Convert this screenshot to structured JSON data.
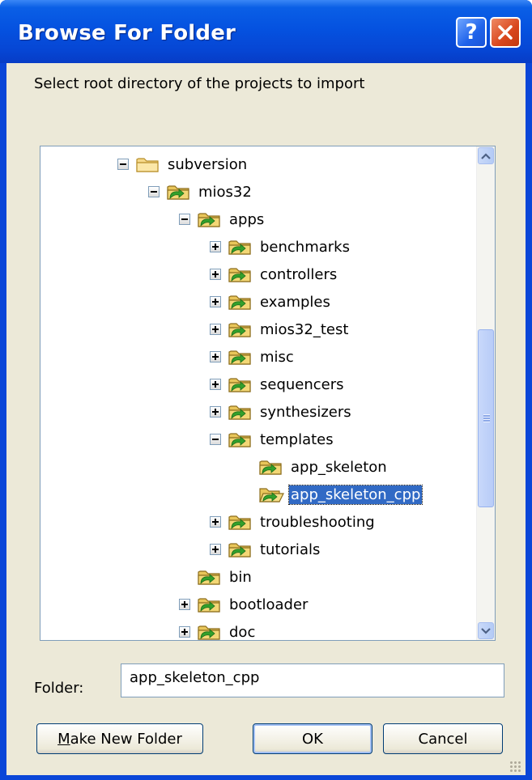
{
  "window": {
    "title": "Browse For Folder",
    "help_label": "?",
    "accent": "#0a46d8"
  },
  "dialog": {
    "instruction": "Select root directory of the projects to import",
    "folder_label": "Folder:",
    "folder_value": "app_skeleton_cpp"
  },
  "tree": {
    "items": [
      {
        "label": "subversion",
        "expander": "minus",
        "icon": "folder-icon"
      },
      {
        "label": "mios32",
        "expander": "minus",
        "icon": "svn-folder-icon"
      },
      {
        "label": "apps",
        "expander": "minus",
        "icon": "svn-folder-icon"
      },
      {
        "label": "benchmarks",
        "expander": "plus",
        "icon": "svn-folder-icon"
      },
      {
        "label": "controllers",
        "expander": "plus",
        "icon": "svn-folder-icon"
      },
      {
        "label": "examples",
        "expander": "plus",
        "icon": "svn-folder-icon"
      },
      {
        "label": "mios32_test",
        "expander": "plus",
        "icon": "svn-folder-icon"
      },
      {
        "label": "misc",
        "expander": "plus",
        "icon": "svn-folder-icon"
      },
      {
        "label": "sequencers",
        "expander": "plus",
        "icon": "svn-folder-icon"
      },
      {
        "label": "synthesizers",
        "expander": "plus",
        "icon": "svn-folder-icon"
      },
      {
        "label": "templates",
        "expander": "minus",
        "icon": "svn-folder-icon"
      },
      {
        "label": "app_skeleton",
        "expander": "none",
        "icon": "svn-folder-icon"
      },
      {
        "label": "app_skeleton_cpp",
        "expander": "none",
        "icon": "svn-folder-open-icon",
        "selected": true
      },
      {
        "label": "troubleshooting",
        "expander": "plus",
        "icon": "svn-folder-icon"
      },
      {
        "label": "tutorials",
        "expander": "plus",
        "icon": "svn-folder-icon"
      },
      {
        "label": "bin",
        "expander": "none",
        "icon": "svn-folder-icon"
      },
      {
        "label": "bootloader",
        "expander": "plus",
        "icon": "svn-folder-icon"
      },
      {
        "label": "doc",
        "expander": "plus",
        "icon": "svn-folder-icon"
      }
    ]
  },
  "buttons": {
    "make_new_folder_mnemonic": "M",
    "make_new_folder_rest": "ake New Folder",
    "ok": "OK",
    "cancel": "Cancel"
  }
}
